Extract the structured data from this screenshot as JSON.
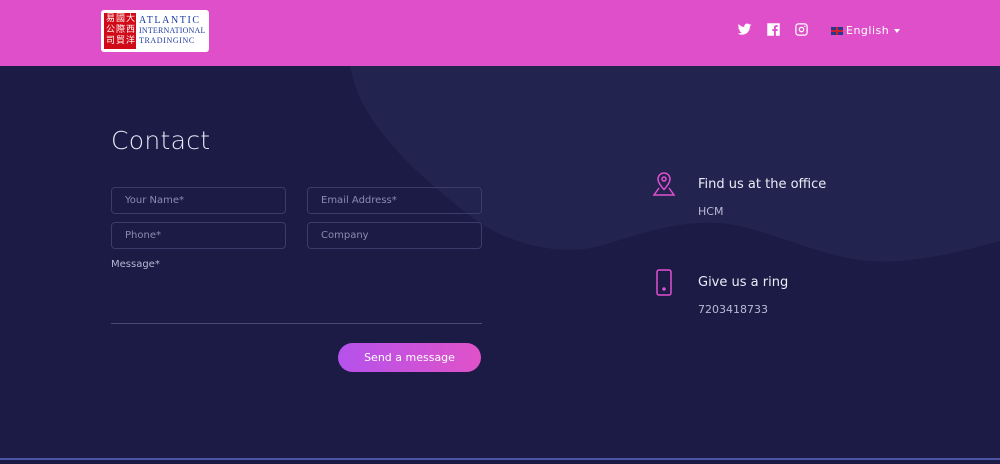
{
  "header": {
    "logo": {
      "seal_chars": [
        "易",
        "國",
        "大",
        "公",
        "際",
        "西",
        "司",
        "貿",
        "洋"
      ],
      "line1": "ATLANTIC",
      "line2": "INTERNATIONAL",
      "line3": "TRADINGINC"
    },
    "social": [
      "twitter-icon",
      "facebook-icon",
      "instagram-icon"
    ],
    "language": "English"
  },
  "contact": {
    "title": "Contact",
    "fields": {
      "name_placeholder": "Your Name*",
      "email_placeholder": "Email Address*",
      "phone_placeholder": "Phone*",
      "company_placeholder": "Company"
    },
    "message_label": "Message*",
    "send_label": "Send a message"
  },
  "info": {
    "office_title": "Find us at the office",
    "office_value": "HCM",
    "ring_title": "Give us a ring",
    "ring_value": "7203418733"
  },
  "colors": {
    "header_bg": "#df4fc9",
    "page_bg": "#1b1b45",
    "accent": "#e24fd0"
  }
}
